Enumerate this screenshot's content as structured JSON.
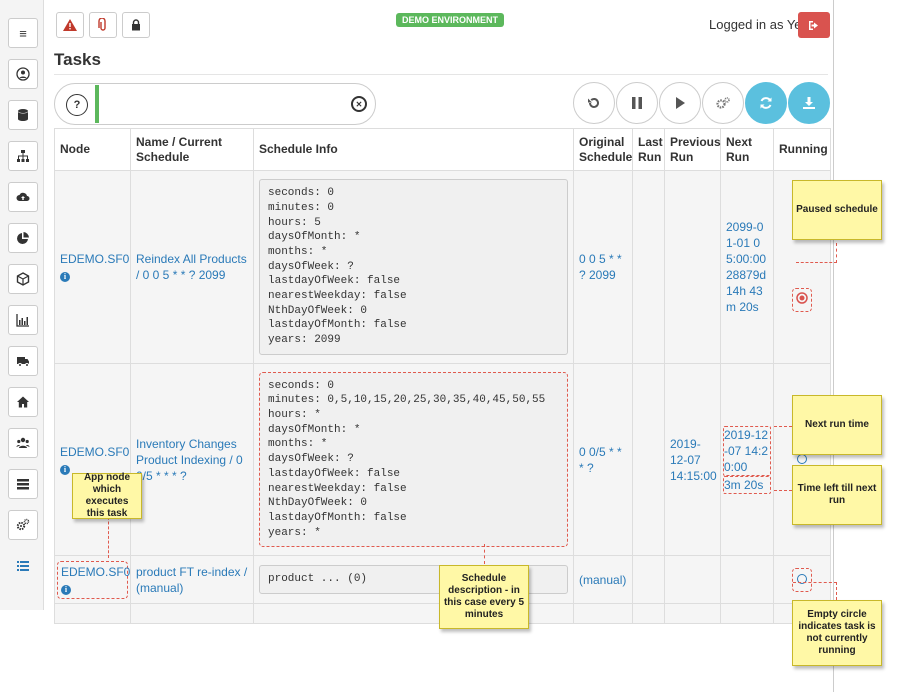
{
  "header": {
    "demo_label": "DEMO ENVIRONMENT",
    "logged_in_text": "Logged in as Yes"
  },
  "page": {
    "title": "Tasks"
  },
  "search": {
    "value": ""
  },
  "table": {
    "headers": {
      "node": "Node",
      "name": "Name / Current Schedule",
      "schedule_info": "Schedule Info",
      "original": "Original Schedule",
      "last_run": "Last Run",
      "previous_run": "Previous Run",
      "next_run": "Next Run",
      "running": "Running"
    },
    "rows": [
      {
        "node": "EDEMO.SF0",
        "name": "Reindex All Products / 0 0 5 * * ? 2099",
        "schedule": "seconds: 0\nminutes: 0\nhours: 5\ndaysOfMonth: *\nmonths: *\ndaysOfWeek: ?\nlastdayOfWeek: false\nnearestWeekday: false\nNthDayOfWeek: 0\nlastdayOfMonth: false\nyears: 2099",
        "original": "0 0 5 * * ? 2099",
        "last_run": "",
        "previous_run": "",
        "next_run": "2099-01-01 05:00:00 28879d 14h 43m 20s",
        "running_state": "paused"
      },
      {
        "node": "EDEMO.SF0",
        "name": "Inventory Changes Product Indexing / 0 0/5 * * * ?",
        "schedule": "seconds: 0\nminutes: 0,5,10,15,20,25,30,35,40,45,50,55\nhours: *\ndaysOfMonth: *\nmonths: *\ndaysOfWeek: ?\nlastdayOfWeek: false\nnearestWeekday: false\nNthDayOfWeek: 0\nlastdayOfMonth: false\nyears: *",
        "original": "0 0/5 * * * ?",
        "last_run": "",
        "previous_run": "2019-12-07 14:15:00",
        "next_run": "2019-12-07 14:20:00",
        "next_run_left": "3m 20s",
        "running_state": "idle"
      },
      {
        "node": "EDEMO.SF0",
        "name": "product FT re-index / (manual)",
        "schedule": "product ... (0)",
        "original": "(manual)",
        "last_run": "",
        "previous_run": "",
        "next_run": "",
        "running_state": "idle"
      }
    ]
  },
  "notes": {
    "paused": "Paused schedule",
    "next_run": "Next run time",
    "time_left": "Time left till next run",
    "app_node": "App node which executes this task",
    "schedule_desc": "Schedule description - in this case every 5 minutes",
    "empty_circle": "Empty circle indicates task is not currently running"
  },
  "colors": {
    "accent": "#2a7ab8",
    "demo": "#5cb85c",
    "logout": "#d9534f",
    "action_blue": "#5bc0de",
    "note": "#fff8a6",
    "annotation": "#e05a4e"
  }
}
